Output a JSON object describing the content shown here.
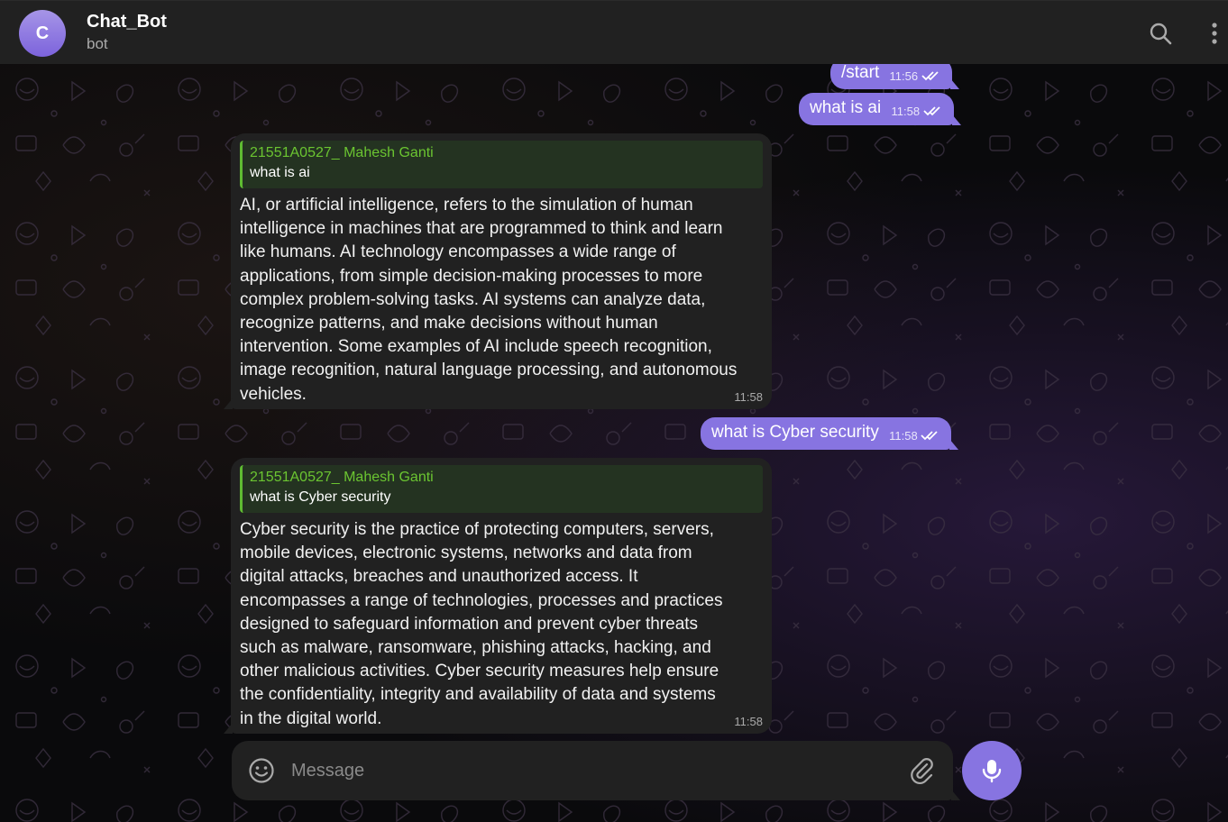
{
  "header": {
    "avatar_letter": "C",
    "title": "Chat_Bot",
    "subtitle": "bot"
  },
  "colors": {
    "accent": "#8774e1",
    "reply_name": "#6bc531",
    "bubble_in": "#212121",
    "header_bg": "#212121"
  },
  "messages": [
    {
      "type": "outgoing",
      "text": "/start",
      "time": "11:56",
      "status": "read"
    },
    {
      "type": "outgoing",
      "text": "what is ai",
      "time": "11:58",
      "status": "read"
    },
    {
      "type": "incoming",
      "reply_to": {
        "name": "21551A0527_ Mahesh Ganti",
        "text": "what is ai"
      },
      "lines": [
        "AI, or artificial intelligence, refers to the simulation of human",
        "intelligence in machines that are programmed to think and learn",
        "like humans. AI technology encompasses a wide range of",
        "applications, from simple decision-making processes to more",
        "complex problem-solving tasks. AI systems can analyze data,",
        "recognize patterns, and make decisions without human",
        "intervention. Some examples of AI include speech recognition,",
        "image recognition, natural language processing, and autonomous",
        "vehicles."
      ],
      "time": "11:58"
    },
    {
      "type": "outgoing",
      "text": "what is Cyber security",
      "time": "11:58",
      "status": "read"
    },
    {
      "type": "incoming",
      "reply_to": {
        "name": "21551A0527_ Mahesh Ganti",
        "text": "what is Cyber security"
      },
      "lines": [
        "Cyber security is the practice of protecting computers, servers,",
        "mobile devices, electronic systems, networks and data from",
        "digital attacks, breaches and unauthorized access. It",
        "encompasses a range of technologies, processes and practices",
        "designed to safeguard information and prevent cyber threats",
        "such as malware, ransomware, phishing attacks, hacking, and",
        "other malicious activities. Cyber security measures help ensure",
        "the confidentiality, integrity and availability of data and systems",
        "in the digital world."
      ],
      "time": "11:58"
    }
  ],
  "composer": {
    "placeholder": "Message"
  },
  "icons": {
    "search": "search-icon",
    "more": "more-vertical-icon",
    "emoji": "emoji-icon",
    "attach": "paperclip-icon",
    "mic": "microphone-icon",
    "read": "double-check-icon"
  }
}
